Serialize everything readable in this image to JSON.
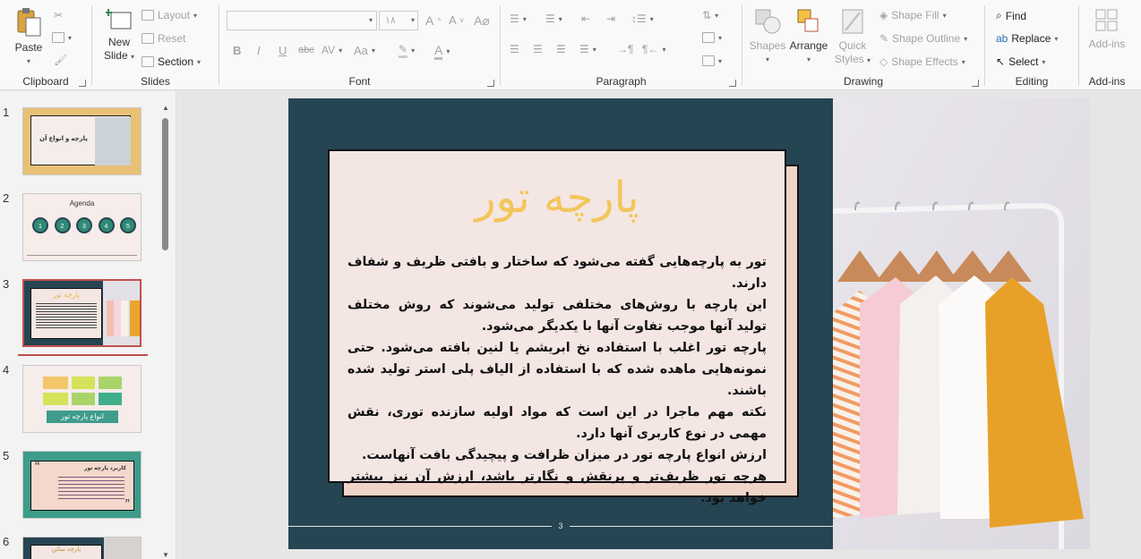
{
  "ribbon": {
    "clipboard": {
      "paste": "Paste",
      "label": "Clipboard"
    },
    "slides": {
      "new_slide_1": "New",
      "new_slide_2": "Slide",
      "layout": "Layout",
      "reset": "Reset",
      "section": "Section",
      "label": "Slides"
    },
    "font": {
      "font_name": "",
      "font_size": "۱۸",
      "label": "Font",
      "bold": "B",
      "italic": "I",
      "underline": "U",
      "strike": "abc",
      "spacing": "AV",
      "case": "Aa",
      "color": "A"
    },
    "paragraph": {
      "label": "Paragraph"
    },
    "drawing": {
      "shapes": "Shapes",
      "arrange": "Arrange",
      "quick_styles_1": "Quick",
      "quick_styles_2": "Styles",
      "shape_fill": "Shape Fill",
      "shape_outline": "Shape Outline",
      "shape_effects": "Shape Effects",
      "label": "Drawing"
    },
    "editing": {
      "find": "Find",
      "replace": "Replace",
      "select": "Select",
      "label": "Editing"
    },
    "addins": {
      "button": "Add-ins",
      "label": "Add-ins"
    }
  },
  "thumbnails": [
    {
      "num": "1",
      "title": "پارچه و انواع آن"
    },
    {
      "num": "2",
      "title": "Agenda",
      "circles": [
        "1",
        "2",
        "3",
        "4",
        "5"
      ]
    },
    {
      "num": "3",
      "title": "پارچه تور"
    },
    {
      "num": "4",
      "title": "انواع پارچه تور"
    },
    {
      "num": "5",
      "title": "کاربرد پارچه تور"
    },
    {
      "num": "6",
      "title": "پارچه ساتن"
    }
  ],
  "slide": {
    "title": "پارچه تور",
    "paragraphs": [
      "تور به پارچه‌هایی گفته می‌شود که ساختار و بافتی ظریف و شفاف دارند.",
      "این پارچه با روش‌های مختلفی تولید می‌شوند که روش مختلف تولید آنها موجب تفاوت آنها با یکدیگر می‌شود.",
      "پارچه تور اغلب با استفاده نخ ابریشم یا لنین بافته می‌شود. حتی نمونه‌هایی ماهده شده که با استفاده از الیاف پلی استر تولید شده باشند.",
      "نکته مهم ماجرا در این است که مواد اولیه سازنده توری، نقش مهمی در نوع کاربری آنها دارد.",
      "ارزش انواع پارچه تور در میزان ظرافت و پیچیدگی بافت آنهاست.",
      "هرچه تور ظریف‌تر و پرنقش و نگارتر باشد، ارزش آن نیز بیشتر خواهد بود."
    ],
    "page_number": "3"
  }
}
